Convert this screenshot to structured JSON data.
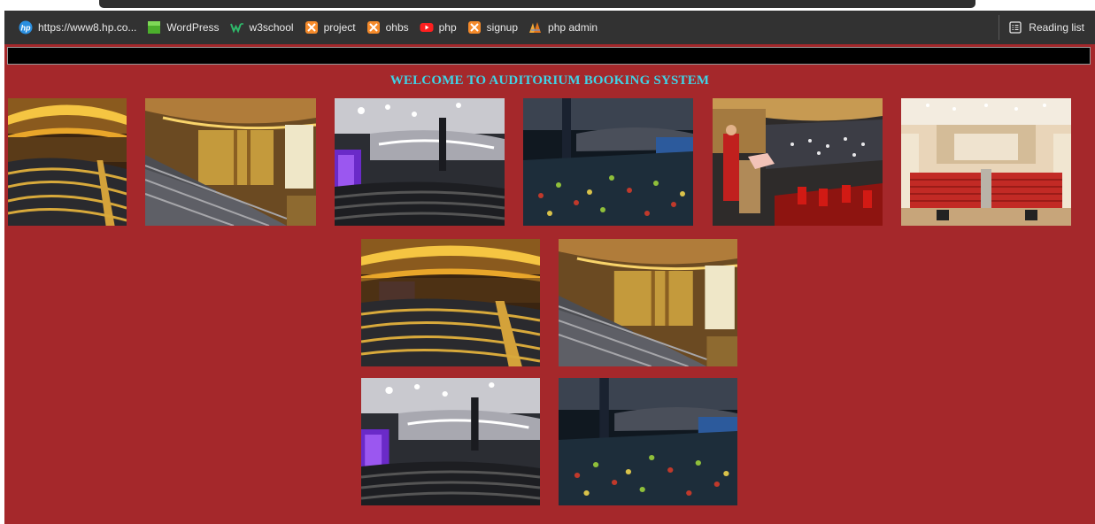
{
  "bookmarks_bar": {
    "items": [
      {
        "label": "https://www8.hp.co...",
        "icon": "hp-logo-icon"
      },
      {
        "label": "WordPress",
        "icon": "green-square-icon"
      },
      {
        "label": "w3school",
        "icon": "w3school-icon"
      },
      {
        "label": "project",
        "icon": "xampp-icon"
      },
      {
        "label": "ohbs",
        "icon": "xampp-icon"
      },
      {
        "label": "php",
        "icon": "youtube-icon"
      },
      {
        "label": "signup",
        "icon": "xampp-icon"
      },
      {
        "label": "php admin",
        "icon": "phpmyadmin-icon"
      }
    ],
    "reading_list": {
      "label": "Reading list",
      "icon": "reading-list-icon"
    }
  },
  "page": {
    "background": "#a5282b",
    "heading": "WELCOME TO AUDITORIUM BOOKING SYSTEM",
    "heading_color": "#3fd3e6",
    "gallery": {
      "images": [
        {
          "scene": "wooden-auditorium-curved-seating"
        },
        {
          "scene": "wooden-auditorium-with-screen"
        },
        {
          "scene": "modern-auditorium-purple-stage"
        },
        {
          "scene": "crowded-auditorium-balcony"
        },
        {
          "scene": "graduation-ceremony-red-gowns"
        },
        {
          "scene": "empty-hall-red-seats"
        },
        {
          "scene": "wooden-auditorium-curved-seating"
        },
        {
          "scene": "wooden-auditorium-with-screen"
        },
        {
          "scene": "modern-auditorium-purple-stage"
        },
        {
          "scene": "crowded-auditorium-balcony"
        }
      ]
    }
  }
}
